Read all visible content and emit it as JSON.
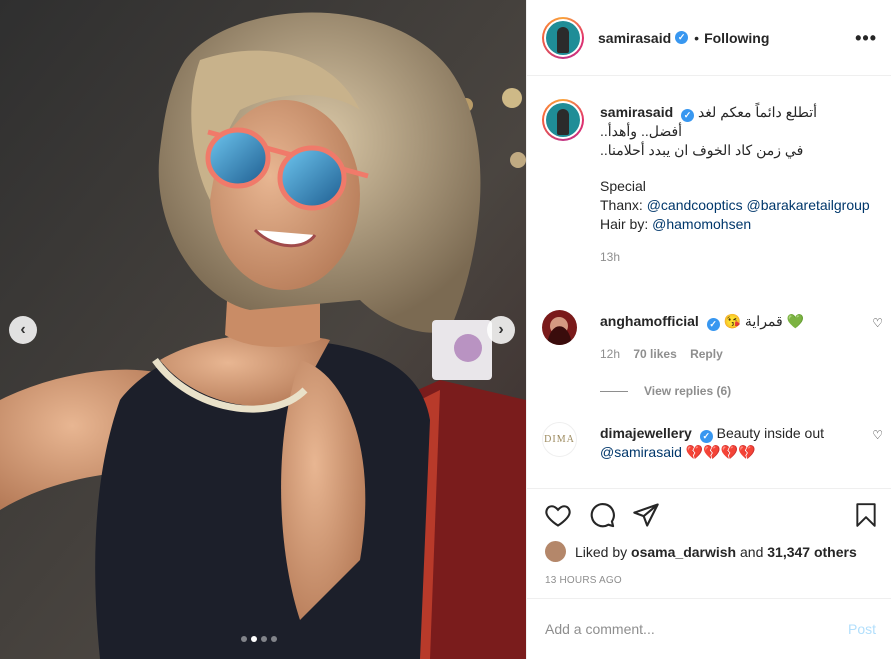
{
  "post": {
    "author": "samirasaid",
    "follow_status": "Following",
    "bullet": "•",
    "more_icon": "more-horizontal-icon",
    "carousel": {
      "slide_count": 4,
      "active_slide": 2
    }
  },
  "caption": {
    "username": "samirasaid",
    "lines": [
      "أتطلع دائماً معكم لغد",
      "أفضل.. وأهدأ..",
      "في زمن كاد الخوف ان يبدد أحلامنا..",
      "Special",
      "Thanx:",
      "Hair by:"
    ],
    "mentions": [
      "@candcooptics",
      "@barakaretailgroup",
      "@hamomohsen"
    ],
    "time": "13h"
  },
  "comments": [
    {
      "username": "anghamofficial",
      "text": "قمراية",
      "emoji_1": "😘",
      "emoji_2": "💚",
      "time": "12h",
      "likes": "70 likes",
      "reply": "Reply",
      "view_replies": "View replies (6)"
    },
    {
      "username": "dimajewellery",
      "avatar_text": "DIMA",
      "text": "Beauty inside out",
      "mention": "@samirasaid",
      "emojis": "💔💔💔💔"
    }
  ],
  "liked_by": {
    "prefix": "Liked by",
    "user": "osama_darwish",
    "conj": "and",
    "others": "31,347 others"
  },
  "timestamp": "13 HOURS AGO",
  "add_comment": {
    "placeholder": "Add a comment...",
    "post_label": "Post"
  },
  "colors": {
    "verified": "#3897f0",
    "link": "#00376b",
    "post_disabled": "#b2dffc"
  }
}
